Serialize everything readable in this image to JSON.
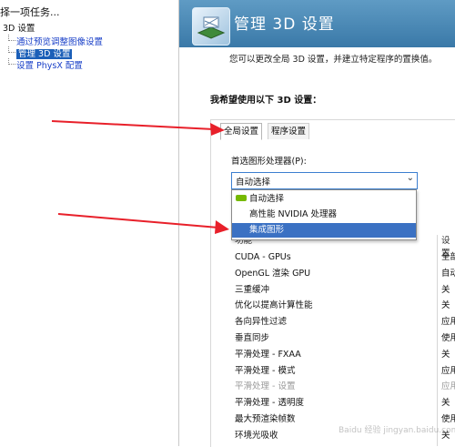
{
  "left": {
    "title": "择一项任务...",
    "tree": {
      "root": "3D 设置",
      "items": [
        {
          "label": "通过预览调整图像设置",
          "selected": false
        },
        {
          "label": "管理 3D 设置",
          "selected": true
        },
        {
          "label": "设置 PhysX 配置",
          "selected": false
        }
      ]
    }
  },
  "header": {
    "title": "管理 3D 设置",
    "subtitle": "您可以更改全局 3D 设置，并建立特定程序的置换值。"
  },
  "settings": {
    "heading": "我希望使用以下 3D 设置：",
    "tabs": [
      {
        "label": "全局设置",
        "active": true
      },
      {
        "label": "程序设置",
        "active": false
      }
    ],
    "processor_label": "首选图形处理器(P):",
    "processor_value": "自动选择",
    "dropdown_options": [
      {
        "label": "自动选择",
        "icon": "nvidia-icon"
      },
      {
        "label": "高性能 NVIDIA 处理器",
        "icon": ""
      },
      {
        "label": "集成图形",
        "icon": "",
        "highlighted": true
      }
    ],
    "grid": {
      "col_feature": "功能",
      "col_setting": "设置",
      "rows": [
        {
          "feature": "CUDA - GPUs",
          "value": "全部",
          "disabled": false
        },
        {
          "feature": "OpenGL 渲染 GPU",
          "value": "自动",
          "disabled": false
        },
        {
          "feature": "三重缓冲",
          "value": "关",
          "disabled": false
        },
        {
          "feature": "优化以提高计算性能",
          "value": "关",
          "disabled": false
        },
        {
          "feature": "各向异性过滤",
          "value": "应用",
          "disabled": false
        },
        {
          "feature": "垂直同步",
          "value": "使用",
          "disabled": false
        },
        {
          "feature": "平滑处理 - FXAA",
          "value": "关",
          "disabled": false
        },
        {
          "feature": "平滑处理 - 模式",
          "value": "应用",
          "disabled": false
        },
        {
          "feature": "平滑处理 - 设置",
          "value": "应用",
          "disabled": true
        },
        {
          "feature": "平滑处理 - 透明度",
          "value": "关",
          "disabled": false
        },
        {
          "feature": "最大预渲染帧数",
          "value": "使用",
          "disabled": false
        },
        {
          "feature": "环境光吸收",
          "value": "关",
          "disabled": false
        }
      ]
    }
  },
  "annotation_color": "#e8202a",
  "watermark": "Baidu 经验 jingyan.baidu.com"
}
